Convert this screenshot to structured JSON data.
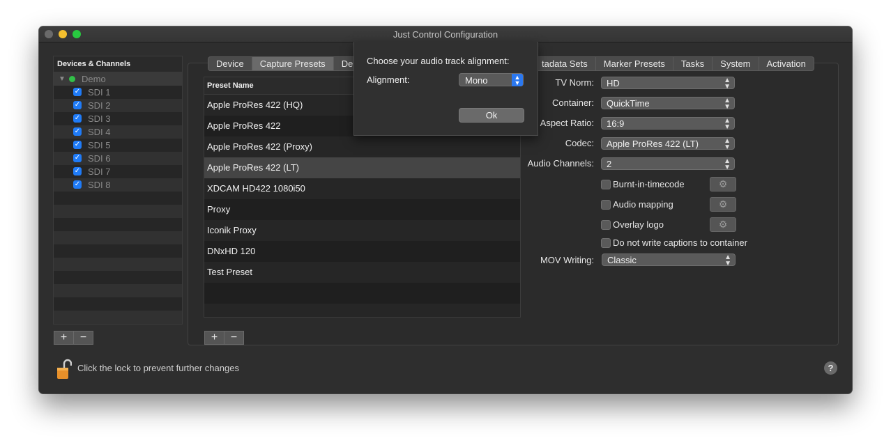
{
  "window": {
    "title": "Just Control Configuration"
  },
  "devices": {
    "header": "Devices & Channels",
    "root_label": "Demo",
    "channels": [
      "SDI 1",
      "SDI 2",
      "SDI 3",
      "SDI 4",
      "SDI 5",
      "SDI 6",
      "SDI 7",
      "SDI 8"
    ],
    "add_label": "+",
    "remove_label": "−"
  },
  "tabs": {
    "left": [
      "Device",
      "Capture Presets",
      "De"
    ],
    "right": [
      "tadata Sets",
      "Marker Presets",
      "Tasks",
      "System",
      "Activation"
    ],
    "active": "Capture Presets"
  },
  "presets": {
    "header": "Preset Name",
    "rows": [
      "Apple ProRes 422 (HQ)",
      "Apple ProRes 422",
      "Apple ProRes 422 (Proxy)",
      "Apple ProRes 422 (LT)",
      "XDCAM HD422 1080i50",
      "Proxy",
      "Iconik Proxy",
      "DNxHD 120",
      "Test Preset"
    ],
    "selected": "Apple ProRes 422 (LT)",
    "add_label": "+",
    "remove_label": "−"
  },
  "form": {
    "tv_norm": {
      "label": "TV Norm:",
      "value": "HD"
    },
    "container": {
      "label": "Container:",
      "value": "QuickTime"
    },
    "aspect_ratio": {
      "label": "Aspect Ratio:",
      "value": "16:9"
    },
    "codec": {
      "label": "Codec:",
      "value": "Apple ProRes 422 (LT)"
    },
    "audio_channels": {
      "label": "Audio Channels:",
      "value": "2"
    },
    "burnt_in_timecode": "Burnt-in-timecode",
    "audio_mapping": "Audio mapping",
    "overlay_logo": "Overlay logo",
    "no_captions": "Do not write captions to container",
    "mov_writing": {
      "label": "MOV Writing:",
      "value": "Classic"
    }
  },
  "sheet": {
    "message": "Choose your audio track alignment:",
    "alignment_label": "Alignment:",
    "alignment_value": "Mono",
    "ok_label": "Ok"
  },
  "footer": {
    "lock_text": "Click the lock to prevent further changes",
    "help_label": "?"
  },
  "colors": {
    "accent": "#1f7bf7",
    "window_bg": "#2e2e2e",
    "selected_row": "#454545"
  }
}
